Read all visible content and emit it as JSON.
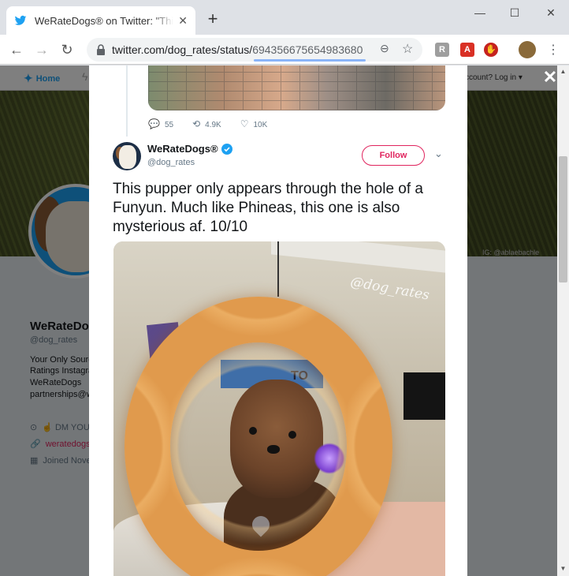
{
  "browser": {
    "tab_title": "WeRateDogs® on Twitter: \"This p",
    "tab_close": "✕",
    "new_tab": "+",
    "url_host": "twitter.com/dog_rates/status/",
    "url_id": "694356675654983680",
    "window_controls": {
      "minimize": "—",
      "maximize": "☐",
      "close": "✕"
    }
  },
  "background_page": {
    "nav_home": "Home",
    "login_text": "ccount? Log in ▾",
    "banner_credit": "IG: @ablaebachle",
    "profile_name": "WeRateDo",
    "profile_handle": "@dog_rates",
    "bio_lines": [
      "Your Only Sourc",
      "Ratings Instagra",
      "WeRateDogs",
      "partnerships@w"
    ],
    "meta_dm": "☝ DM YOUR",
    "meta_link": "weratedogs.",
    "meta_joined": "Joined Nove",
    "colors": {
      "link": "#e0245e"
    }
  },
  "prev_tweet": {
    "replies": "55",
    "retweets": "4.9K",
    "likes": "10K"
  },
  "tweet": {
    "author_name": "WeRateDogs®",
    "author_handle": "@dog_rates",
    "follow_label": "Follow",
    "text": "This pupper only appears through the hole of a Funyun. Much like Phineas, this one is also mysterious af. 10/10",
    "media_watermark": "@dog_rates",
    "poster_text": "TO"
  },
  "overlay": {
    "close": "✕"
  },
  "colors": {
    "twitter_blue": "#1da1f2",
    "follow_accent": "#e0245e",
    "url_highlight": "#8ab4f8"
  }
}
